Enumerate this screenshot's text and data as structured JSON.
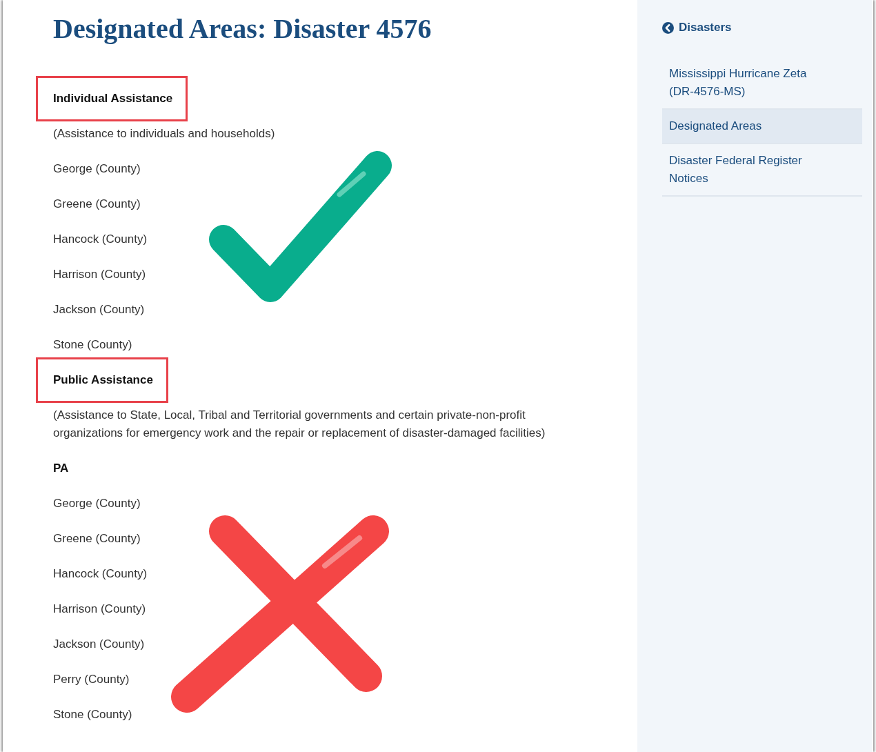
{
  "title": "Designated Areas: Disaster 4576",
  "sections": [
    {
      "heading": "Individual Assistance",
      "highlighted": true,
      "description": "(Assistance to individuals and households)",
      "areas": [
        "George (County)",
        "Greene (County)",
        "Hancock (County)",
        "Harrison (County)",
        "Jackson (County)",
        "Stone (County)"
      ]
    },
    {
      "heading": "Public Assistance",
      "highlighted": true,
      "description": "(Assistance to State, Local, Tribal and Territorial governments and certain private-non-profit organizations for emergency work and the repair or replacement of disaster-damaged facilities)",
      "subheading": "PA",
      "areas": [
        "George (County)",
        "Greene (County)",
        "Hancock (County)",
        "Harrison (County)",
        "Jackson (County)",
        "Perry (County)",
        "Stone (County)"
      ]
    }
  ],
  "annotations": [
    {
      "kind": "check"
    },
    {
      "kind": "cross"
    }
  ],
  "sidebar": {
    "back_link": "Disasters",
    "items": [
      {
        "label": "Mississippi Hurricane Zeta (DR-4576-MS)",
        "selected": false
      },
      {
        "label": "Designated Areas",
        "selected": true
      },
      {
        "label": "Disaster Federal Register Notices",
        "selected": false
      }
    ]
  }
}
